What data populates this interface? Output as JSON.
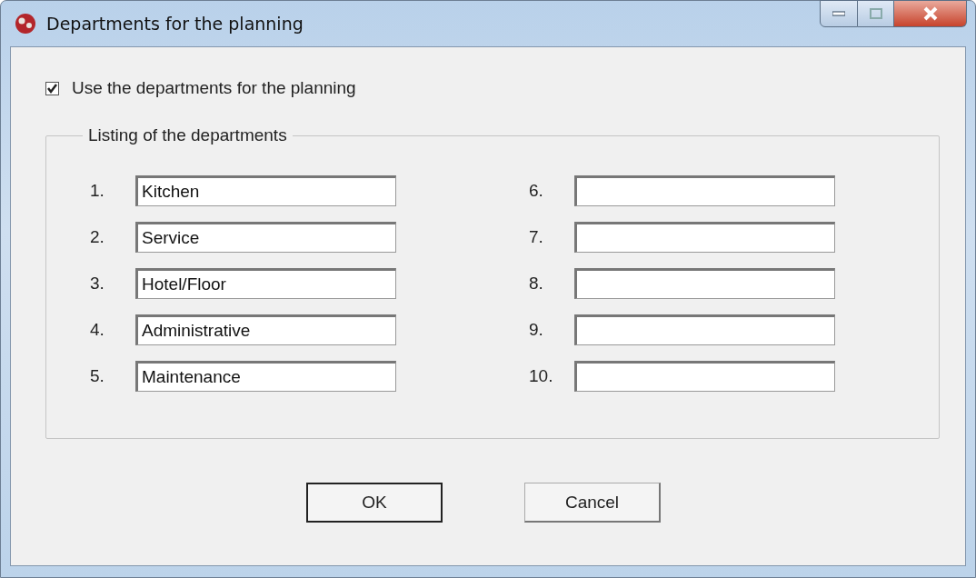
{
  "window": {
    "title": "Departments for the planning"
  },
  "use_departments": {
    "label": "Use the departments for the planning",
    "checked": true
  },
  "listing": {
    "legend": "Listing of the departments",
    "departments": [
      {
        "number": "1.",
        "value": "Kitchen"
      },
      {
        "number": "2.",
        "value": "Service"
      },
      {
        "number": "3.",
        "value": "Hotel/Floor"
      },
      {
        "number": "4.",
        "value": "Administrative"
      },
      {
        "number": "5.",
        "value": "Maintenance"
      },
      {
        "number": "6."
      },
      {
        "number": "7."
      },
      {
        "number": "8."
      },
      {
        "number": "9."
      },
      {
        "number": "10."
      }
    ]
  },
  "buttons": [
    {
      "label": "OK",
      "default": true
    },
    {
      "label": "Cancel",
      "default": false
    }
  ]
}
